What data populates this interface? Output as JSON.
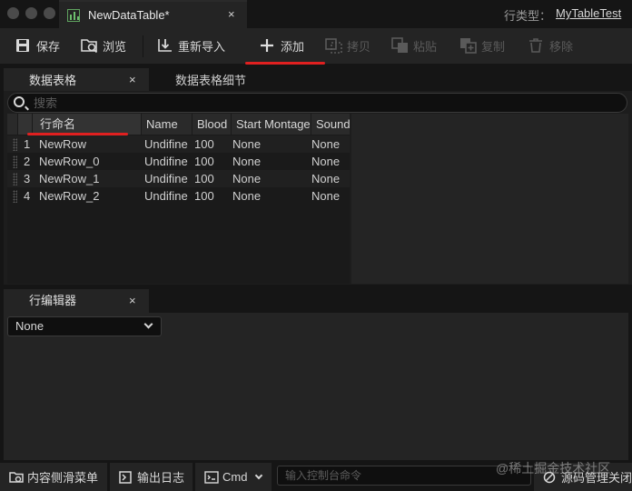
{
  "document_tab": {
    "title": "NewDataTable*",
    "close": "×"
  },
  "row_type": {
    "label": "行类型：",
    "value": "MyTableTest"
  },
  "toolbar": {
    "save": "保存",
    "browse": "浏览",
    "reimport": "重新导入",
    "add": "添加",
    "copy": "拷贝",
    "paste": "粘贴",
    "duplicate": "复制",
    "remove": "移除"
  },
  "panel_tabs": {
    "data_table": "数据表格",
    "data_table_details": "数据表格细节",
    "close": "×"
  },
  "search": {
    "placeholder": "搜索"
  },
  "table": {
    "columns": [
      "行命名",
      "Name",
      "Blood",
      "Start Montage",
      "Sound"
    ],
    "rows": [
      {
        "index": "1",
        "row_name": "NewRow",
        "name": "Undifine",
        "blood": "100",
        "start_montage": "None",
        "sound": "None"
      },
      {
        "index": "2",
        "row_name": "NewRow_0",
        "name": "Undifine",
        "blood": "100",
        "start_montage": "None",
        "sound": "None"
      },
      {
        "index": "3",
        "row_name": "NewRow_1",
        "name": "Undifine",
        "blood": "100",
        "start_montage": "None",
        "sound": "None"
      },
      {
        "index": "4",
        "row_name": "NewRow_2",
        "name": "Undifine",
        "blood": "100",
        "start_montage": "None",
        "sound": "None"
      }
    ]
  },
  "row_editor": {
    "tab": "行编辑器",
    "close": "×",
    "selected": "None"
  },
  "statusbar": {
    "content_drawer": "内容侧滑菜单",
    "output_log": "输出日志",
    "cmd": "Cmd",
    "cmd_placeholder": "输入控制台命令",
    "source_control": "源码管理关闭"
  },
  "watermark": "@稀土掘金技术社区",
  "colors": {
    "accent_underline": "#e02020",
    "panel": "#242424",
    "background": "#151515"
  }
}
